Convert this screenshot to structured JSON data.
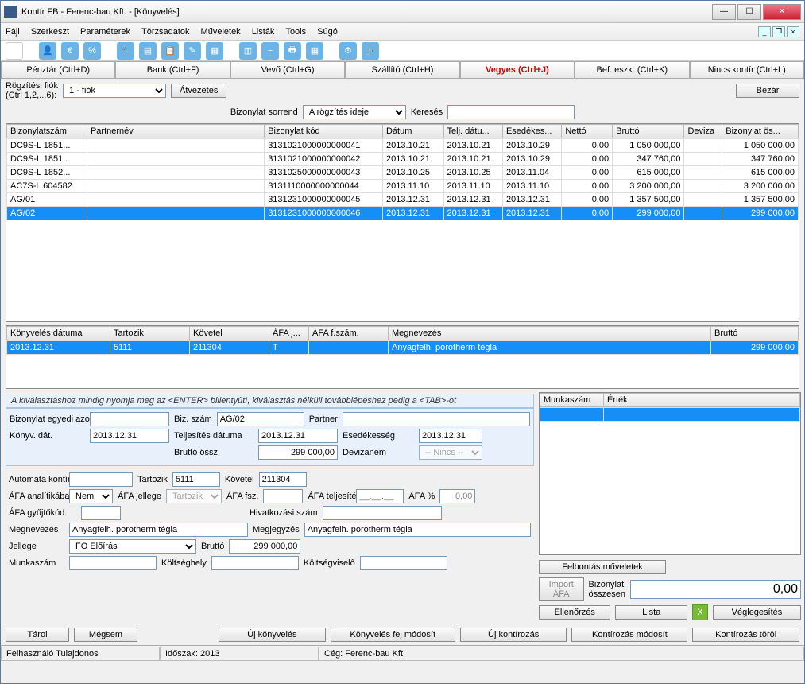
{
  "window": {
    "title": "Kontír FB  - Ferenc-bau Kft. - [Könyvelés]"
  },
  "menu": {
    "fajl": "Fájl",
    "szerkeszt": "Szerkeszt",
    "parameterek": "Paraméterek",
    "torzsadatok": "Törzsadatok",
    "muveletek": "Műveletek",
    "listak": "Listák",
    "tools": "Tools",
    "sugo": "Súgó"
  },
  "tabs": {
    "penztar": "Pénztár (Ctrl+D)",
    "bank": "Bank (Ctrl+F)",
    "vevo": "Vevő (Ctrl+G)",
    "szallito": "Szállító (Ctrl+H)",
    "vegyes": "Vegyes (Ctrl+J)",
    "befeszk": "Bef. eszk. (Ctrl+K)",
    "nincs": "Nincs kontír (Ctrl+L)"
  },
  "topControls": {
    "rogzLabel": "Rögzítési fiók\n(Ctrl 1,2,...6):",
    "rogzValue": "1 - fiók",
    "atvezetes": "Átvezetés",
    "bezar": "Bezár",
    "bizSorrend": "Bizonylat sorrend",
    "bizSorrendVal": "A rögzítés ideje",
    "kereses": "Keresés"
  },
  "grid1": {
    "headers": [
      "Bizonylatszám",
      "Partnernév",
      "Bizonylat kód",
      "Dátum",
      "Telj. dátu...",
      "Esedékes...",
      "Nettó",
      "Bruttó",
      "Deviza",
      "Bizonylat ös..."
    ],
    "rows": [
      {
        "c": [
          "DC9S-L 1851...",
          "",
          "3131021000000000041",
          "2013.10.21",
          "2013.10.21",
          "2013.10.29",
          "0,00",
          "1 050 000,00",
          "",
          "1 050 000,00"
        ],
        "sel": false
      },
      {
        "c": [
          "DC9S-L 1851...",
          "",
          "3131021000000000042",
          "2013.10.21",
          "2013.10.21",
          "2013.10.29",
          "0,00",
          "347 760,00",
          "",
          "347 760,00"
        ],
        "sel": false
      },
      {
        "c": [
          "DC9S-L 1852...",
          "",
          "3131025000000000043",
          "2013.10.25",
          "2013.10.25",
          "2013.11.04",
          "0,00",
          "615 000,00",
          "",
          "615 000,00"
        ],
        "sel": false
      },
      {
        "c": [
          "AC7S-L 604582",
          "",
          "3131110000000000044",
          "2013.11.10",
          "2013.11.10",
          "2013.11.10",
          "0,00",
          "3 200 000,00",
          "",
          "3 200 000,00"
        ],
        "sel": false
      },
      {
        "c": [
          "AG/01",
          "",
          "3131231000000000045",
          "2013.12.31",
          "2013.12.31",
          "2013.12.31",
          "0,00",
          "1 357 500,00",
          "",
          "1 357 500,00"
        ],
        "sel": false
      },
      {
        "c": [
          "AG/02",
          "",
          "3131231000000000046",
          "2013.12.31",
          "2013.12.31",
          "2013.12.31",
          "0,00",
          "299 000,00",
          "",
          "299 000,00"
        ],
        "sel": true
      }
    ]
  },
  "grid2": {
    "headers": [
      "Könyvelés dátuma",
      "Tartozik",
      "Követel",
      "ÁFA j...",
      "ÁFA f.szám.",
      "Megnevezés",
      "Bruttó"
    ],
    "rows": [
      {
        "c": [
          "2013.12.31",
          "5111",
          "211304",
          "T",
          "",
          "Anyagfelh. porotherm tégla",
          "299 000,00"
        ],
        "sel": true
      }
    ]
  },
  "hint": "A kiválasztáshoz mindig nyomja meg az <ENTER> billentyűt!, kiválasztás nélküli továbblépéshez pedig a <TAB>-ot",
  "form": {
    "bizEgyediLabel": "Bizonylat egyedi azonosító",
    "bizSzamLabel": "Biz. szám",
    "bizSzam": "AG/02",
    "partnerLabel": "Partner",
    "konyvDatLabel": "Könyv. dát.",
    "konyvDat": "2013.12.31",
    "teljDatLabel": "Teljesítés dátuma",
    "teljDat": "2013.12.31",
    "esedLabel": "Esedékesség",
    "esed": "2013.12.31",
    "bruttoOsszLabel": "Bruttó össz.",
    "bruttoOssz": "299 000,00",
    "devizanemLabel": "Devizanem",
    "devizanem": "-- Nincs --",
    "automataLabel": "Automata kontírkód:",
    "tartozikLabel": "Tartozik",
    "tartozik": "5111",
    "kovetelLabel": "Követel",
    "kovetel": "211304",
    "afaAnalLabel": "ÁFA analítikába",
    "afaAnal": "Nem",
    "afaJellegeLabel": "ÁFA jellege",
    "afaJellege": "Tartozik",
    "afaFszLabel": "ÁFA fsz.",
    "afaTeljLabel": "ÁFA teljesítés",
    "afaTeljPlaceholder": "__.__.__",
    "afaPctLabel": "ÁFA %",
    "afaPct": "0,00",
    "afaGyujtoLabel": "ÁFA gyűjtőkód.",
    "hivSzamLabel": "Hivatkozási szám",
    "megnevezesLabel": "Megnevezés",
    "megnevezes": "Anyagfelh. porotherm tégla",
    "megjegyzesLabel": "Megjegyzés",
    "megjegyzes": "Anyagfelh. porotherm tégla",
    "jellegeLabel": "Jellege",
    "jellege": "FO Előírás",
    "bruttoLabel": "Bruttó",
    "brutto": "299 000,00",
    "munkaszamLabel": "Munkaszám",
    "koltseghelyLabel": "Költséghely",
    "koltsegviseloLabel": "Költségviselő"
  },
  "rightPanel": {
    "h1": "Munkaszám",
    "h2": "Érték",
    "felbontas": "Felbontás műveletek",
    "importAfa": "Import ÁFA",
    "bizOsszLabel": "Bizonylat összesen",
    "bizOssz": "0,00",
    "ellenorzes": "Ellenőrzés",
    "lista": "Lista",
    "veglegesites": "Véglegesítés"
  },
  "bottomBtns": {
    "tarol": "Tárol",
    "megsem": "Mégsem",
    "ujKonyv": "Új könyvelés",
    "konyvFej": "Könyvelés fej módosít",
    "ujKontir": "Új kontírozás",
    "kontirMod": "Kontírozás módosít",
    "kontirTorol": "Kontírozás töröl"
  },
  "status": {
    "felh": "Felhasználó Tulajdonos",
    "idoszak": "Időszak: 2013",
    "ceg": "Cég: Ferenc-bau Kft."
  }
}
